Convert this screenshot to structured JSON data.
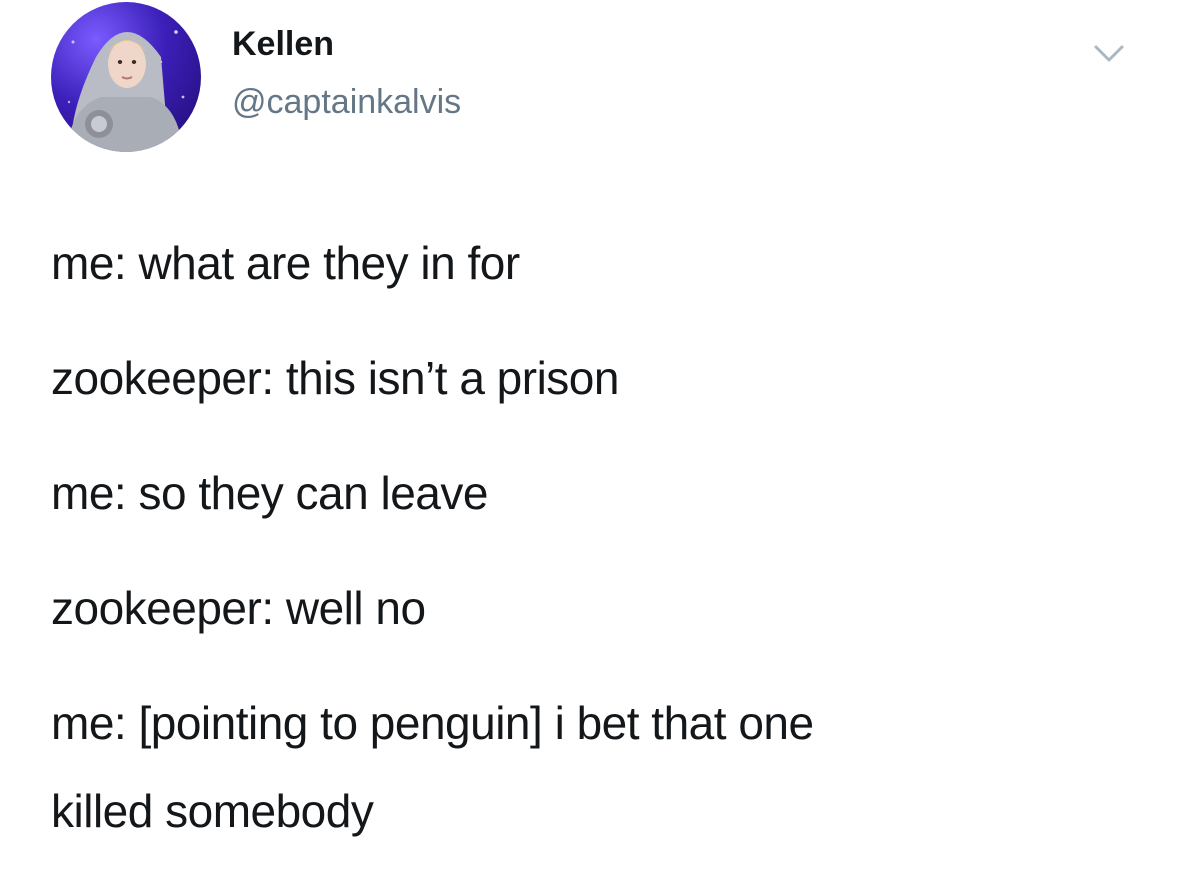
{
  "tweet": {
    "author": {
      "display_name": "Kellen",
      "handle": "@captainkalvis",
      "avatar_icon": "profile-photo"
    },
    "menu_icon": "chevron-down-icon",
    "lines": [
      "me: what are they in for",
      "zookeeper: this isn’t a prison",
      "me: so they can leave",
      "zookeeper: well no",
      "me: [pointing to penguin] i bet that one",
      "killed somebody"
    ]
  },
  "colors": {
    "text": "#14171a",
    "secondary_text": "#657786",
    "background": "#ffffff",
    "avatar_bg": "#3b1fb8"
  }
}
